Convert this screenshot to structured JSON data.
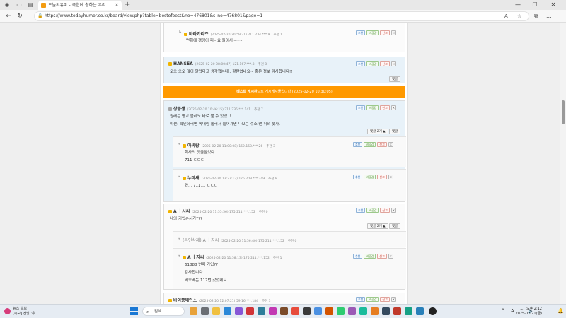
{
  "browser": {
    "tab_title": "오늘의유머 - 극한에 승하는 우리",
    "tab_close": "×",
    "new_tab": "+",
    "url": "https://www.todayhumor.co.kr/board/view.php?table=bestofbest&no=476801&s_no=476801&page=1",
    "win_min": "—",
    "win_max": "☐",
    "win_close": "✕",
    "extensions_label": "...",
    "read_aloud": "A",
    "star": "☆",
    "collections": "⧉"
  },
  "buttons": {
    "recommend": "추천",
    "oppose": "비공감",
    "report": "신고",
    "close": "✕",
    "reply": "댓글",
    "reply_count_2": "댓글 2개 ▲"
  },
  "comments": [
    {
      "author": "바라카리즈",
      "meta": "(2025-02-20 20:59:21)",
      "ip": "211.234.***.9",
      "rec": "추천 1",
      "text": "면회에 갱갱이 피나요 들이서~~~"
    },
    {
      "author": "HANSEA",
      "meta": "(2025-02-20 08:00:47)",
      "ip": "121.167.***.3",
      "rec": "추천 8",
      "text": "오오 오오 많이 깔렸다고 생각했는데;; 활탄없네요~ 좋은 정보 감사합니다!!"
    },
    {
      "author": "상꽁생",
      "meta": "(2025-02-20 10:46:15)",
      "ip": "211.235.***.141",
      "rec": "추천 7",
      "text1": "원래는 명교 불레도 바로 뿔 수 있었고",
      "text2": "이젠: 확인하러면 녹내림 놀러서 들어가면 나오는 주소 맨 뒤의 숫자."
    },
    {
      "author": "아싸랑",
      "meta": "(2025-02-20 11:00:08)",
      "ip": "162.158.***.26",
      "rec": "추천 3",
      "text1": "회사의 댓글달었다",
      "text2": "711 ㄷㄷㄷ"
    },
    {
      "author": "누마새",
      "meta": "(2025-02-20 13:27:13)",
      "ip": "175.209.***.249",
      "rec": "추천 8",
      "text": "와... 711.... ㄷㄷㄷ"
    },
    {
      "author": "A ㅏ시씨",
      "meta": "(2025-02-20 11:55:56)",
      "ip": "175.211.***.152",
      "rec": "추천 0",
      "text": "나의 기입순서가???"
    },
    {
      "author": "(본인삭제) A ㅏ지씨",
      "meta": "(2025-02-20 11:56:40)",
      "ip": "175.211.***.152",
      "rec": "추천 0"
    },
    {
      "author": "A ㅏ지씨",
      "meta": "(2025-02-20 11:58:13)",
      "ip": "175.211.***.152",
      "rec": "추천 1",
      "text1": "61888 번째 가입??",
      "text2": "감사합니다...",
      "text3": "베오베는 117번 갔었네요"
    },
    {
      "author": "바이쭝쎄인스",
      "meta": "(2025-02-20 12:07:21)",
      "ip": "59.16.***.184",
      "rec": "추천 3"
    }
  ],
  "notice": {
    "bold": "베스트 게시판",
    "text": "으로 게시게시물입니다 (2025-02-20 10:30:05)"
  },
  "taskbar": {
    "weather_title": "뉴스 속보",
    "weather_sub": "[속보] 전방 '우...",
    "search_placeholder": "검색",
    "time": "오후 2:12",
    "date": "2025-02-21(금)",
    "lang": "A",
    "up_arrow": "^"
  }
}
